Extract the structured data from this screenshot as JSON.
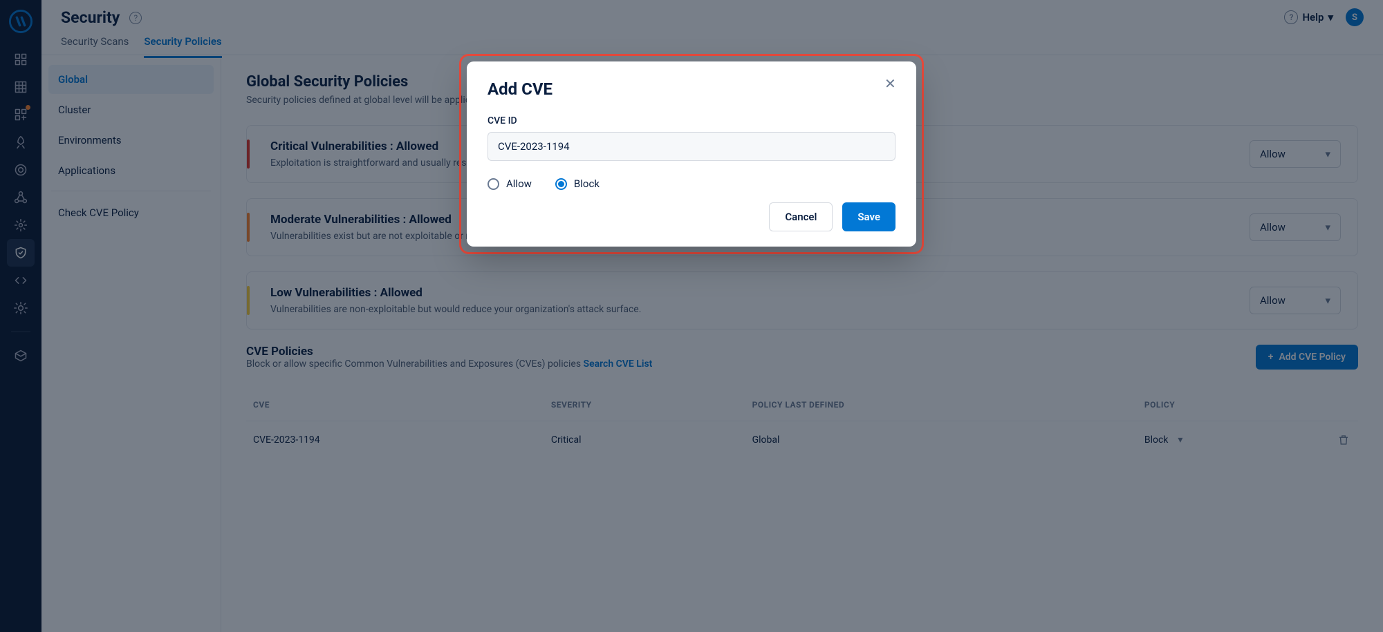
{
  "header": {
    "title": "Security",
    "help_label": "Help",
    "avatar_initial": "S",
    "tabs": [
      {
        "label": "Security Scans",
        "active": false
      },
      {
        "label": "Security Policies",
        "active": true
      }
    ]
  },
  "rail": {
    "items": [
      {
        "name": "dashboard-icon",
        "notify": false
      },
      {
        "name": "grid-icon",
        "notify": false
      },
      {
        "name": "deploy-icon",
        "notify": true
      },
      {
        "name": "rocket-icon",
        "notify": false
      },
      {
        "name": "target-icon",
        "notify": false
      },
      {
        "name": "cluster-icon",
        "notify": false
      },
      {
        "name": "gear-icon",
        "notify": false
      },
      {
        "name": "shield-icon",
        "notify": false,
        "active": true
      },
      {
        "name": "code-icon",
        "notify": false
      },
      {
        "name": "settings2-icon",
        "notify": false
      }
    ],
    "bottom": [
      {
        "name": "cube-icon"
      }
    ]
  },
  "sidebar": {
    "items": [
      {
        "label": "Global",
        "active": true
      },
      {
        "label": "Cluster"
      },
      {
        "label": "Environments"
      },
      {
        "label": "Applications"
      }
    ],
    "secondary": [
      {
        "label": "Check CVE Policy"
      }
    ]
  },
  "main": {
    "title": "Global Security Policies",
    "subtitle": "Security policies defined at global level will be applicable to all applications across all environments.",
    "vuln_cards": [
      {
        "level": "red",
        "title": "Critical Vulnerabilities : Allowed",
        "desc": "Exploitation is straightforward and usually results in system-level compromise.",
        "value": "Allow"
      },
      {
        "level": "orange",
        "title": "Moderate Vulnerabilities : Allowed",
        "desc": "Vulnerabilities exist but are not exploitable or require extra steps such as social engineering.",
        "value": "Allow"
      },
      {
        "level": "yellow",
        "title": "Low Vulnerabilities : Allowed",
        "desc": "Vulnerabilities are non-exploitable but would reduce your organization's attack surface.",
        "value": "Allow"
      }
    ],
    "cve_section": {
      "title": "CVE Policies",
      "desc": "Block or allow specific Common Vulnerabilities and Exposures (CVEs) policies ",
      "link": "Search CVE List",
      "add_button": "Add CVE Policy"
    },
    "cve_table": {
      "cols": [
        "CVE",
        "SEVERITY",
        "POLICY LAST DEFINED",
        "POLICY"
      ],
      "rows": [
        {
          "cve": "CVE-2023-1194",
          "severity": "Critical",
          "defined": "Global",
          "policy": "Block"
        }
      ]
    }
  },
  "modal": {
    "title": "Add CVE",
    "field_label": "CVE ID",
    "field_value": "CVE-2023-1194",
    "options": [
      {
        "label": "Allow",
        "checked": false
      },
      {
        "label": "Block",
        "checked": true
      }
    ],
    "cancel": "Cancel",
    "save": "Save"
  }
}
